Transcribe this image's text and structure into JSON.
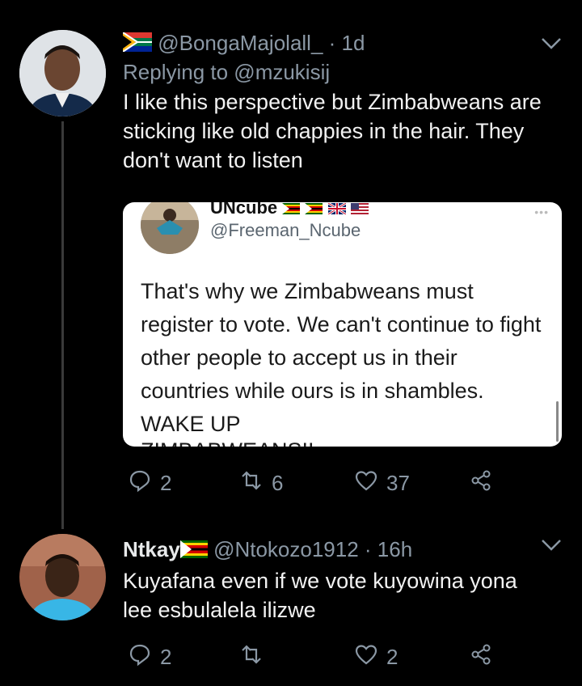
{
  "tweets": [
    {
      "flag_prefix": "za-flag",
      "handle": "@BongaMajolall_",
      "time": "· 1d",
      "replying_to": "Replying to @mzukisij",
      "text": "I like this perspective but Zimbabweans are sticking like old chappies in the hair. They don't want to listen",
      "counts": {
        "reply": "2",
        "retweet": "6",
        "like": "37"
      }
    },
    {
      "name": "Ntkay",
      "handle": "@Ntokozo1912",
      "time": "· 16h",
      "text": "Kuyafana even if we vote kuyowina yona lee esbulalela ilizwe",
      "counts": {
        "reply": "2",
        "retweet": "",
        "like": "2"
      }
    }
  ],
  "embedded_card": {
    "name": "UNcube",
    "handle": "@Freeman_Ncube",
    "text": "That's why we Zimbabweans must register to vote. We can't continue to fight other people to accept us in their countries while ours is in shambles. WAKE UP",
    "cut_text": "ZIMBABWEANS!!",
    "dots": "•••"
  },
  "icons": [
    "reply-icon",
    "retweet-icon",
    "like-icon",
    "share-icon",
    "chevron-down-icon"
  ],
  "colors": {
    "background": "#000000",
    "secondary_text": "#8b98a5",
    "thread_line": "#3a3a3a"
  }
}
